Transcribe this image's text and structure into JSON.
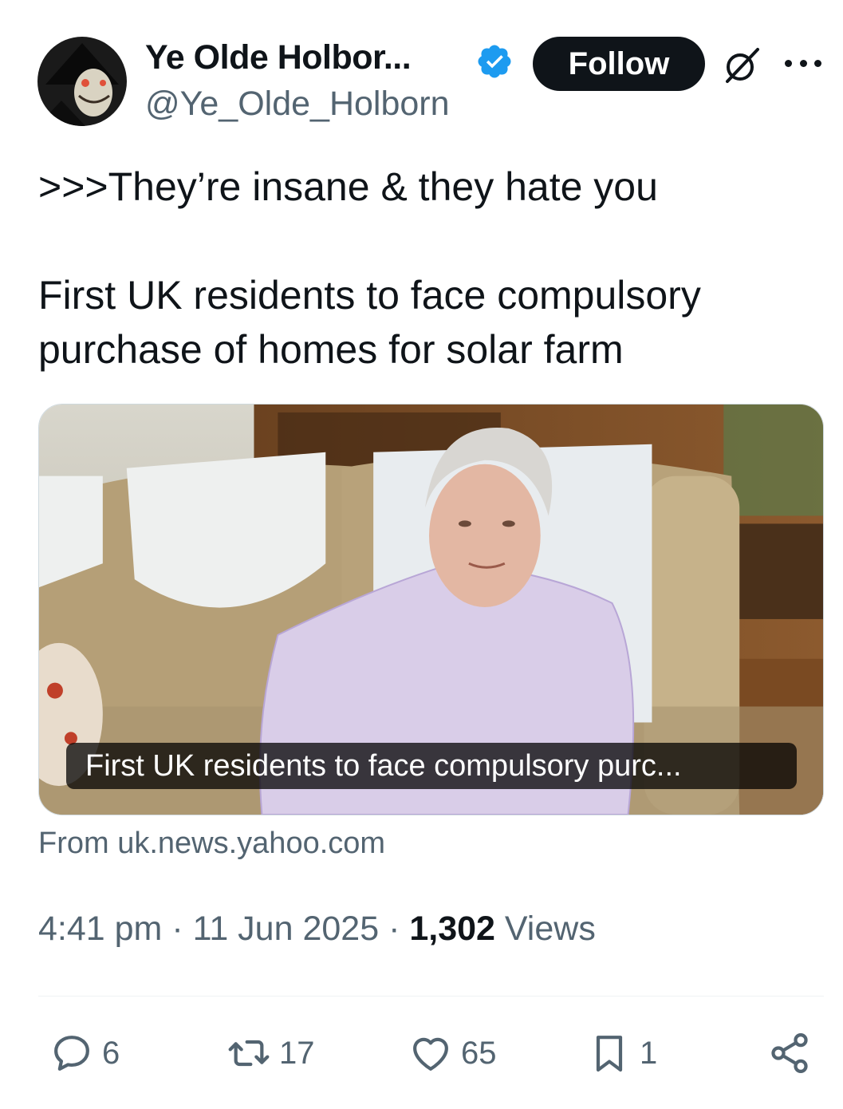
{
  "author": {
    "display_name": "Ye Olde Holbor...",
    "handle": "@Ye_Olde_Holborn",
    "verified": true,
    "verified_color": "#1d9bf0"
  },
  "header": {
    "follow_label": "Follow",
    "grok_icon": "grok-icon",
    "more_icon": "more-icon"
  },
  "tweet": {
    "line1": ">>>They’re insane & they hate you",
    "line2": "First UK residents to face compulsory purchase of homes for solar farm"
  },
  "card": {
    "caption": "First UK residents to face compulsory purc...",
    "source": "From uk.news.yahoo.com"
  },
  "meta": {
    "time": "4:41 pm",
    "separator": " · ",
    "date": "11 Jun 2025",
    "views_count": "1,302",
    "views_label": "Views"
  },
  "actions": {
    "replies": "6",
    "reposts": "17",
    "likes": "65",
    "bookmarks": "1"
  },
  "colors": {
    "text": "#0f1419",
    "secondary": "#536471",
    "divider": "#eff3f4"
  }
}
